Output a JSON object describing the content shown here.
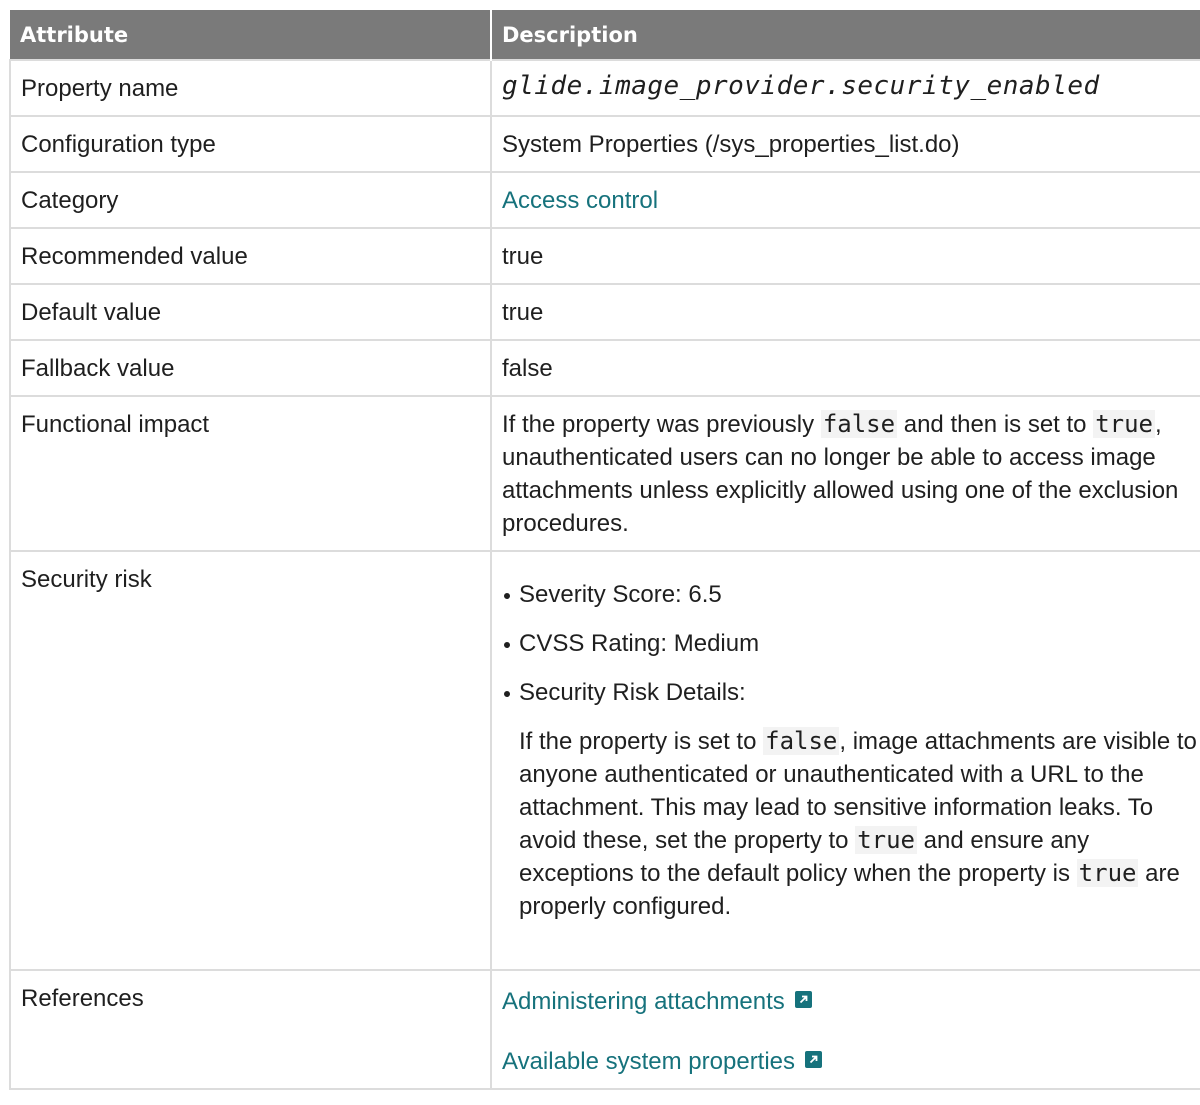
{
  "header": {
    "col_attribute": "Attribute",
    "col_description": "Description"
  },
  "rows": {
    "property_name": {
      "label": "Property name",
      "value": "glide.image_provider.security_enabled"
    },
    "configuration_type": {
      "label": "Configuration type",
      "value": "System Properties (/sys_properties_list.do)"
    },
    "category": {
      "label": "Category",
      "value": "Access control"
    },
    "recommended_value": {
      "label": "Recommended value",
      "value": "true"
    },
    "default_value": {
      "label": "Default value",
      "value": "true"
    },
    "fallback_value": {
      "label": "Fallback value",
      "value": "false"
    },
    "functional_impact": {
      "label": "Functional impact",
      "t1": "If the property was previously ",
      "c1": "false",
      "t2": " and then is set to ",
      "c2": "true",
      "t3": ", unauthenticated users can no longer be able to access image attachments unless explicitly allowed using one of the exclusion procedures."
    },
    "security_risk": {
      "label": "Security risk",
      "bullets": [
        "Severity Score: 6.5",
        "CVSS Rating: Medium",
        "Security Risk Details:"
      ],
      "d1": "If the property is set to ",
      "c1": "false",
      "d2": ", image attachments are visible to anyone authenticated or unauthenticated with a URL to the attachment. This may lead to sensitive information leaks. To avoid these, set the property to ",
      "c2": "true",
      "d3": " and ensure any exceptions to the default policy when the property is ",
      "c3": "true",
      "d4": " are properly configured."
    },
    "references": {
      "label": "References",
      "links": [
        "Administering attachments",
        "Available system properties"
      ]
    }
  },
  "colors": {
    "header_bg": "#7a7a7a",
    "link": "#16727c",
    "border": "#dcdcdc"
  },
  "icons": {
    "external_link": "external-link-icon"
  }
}
